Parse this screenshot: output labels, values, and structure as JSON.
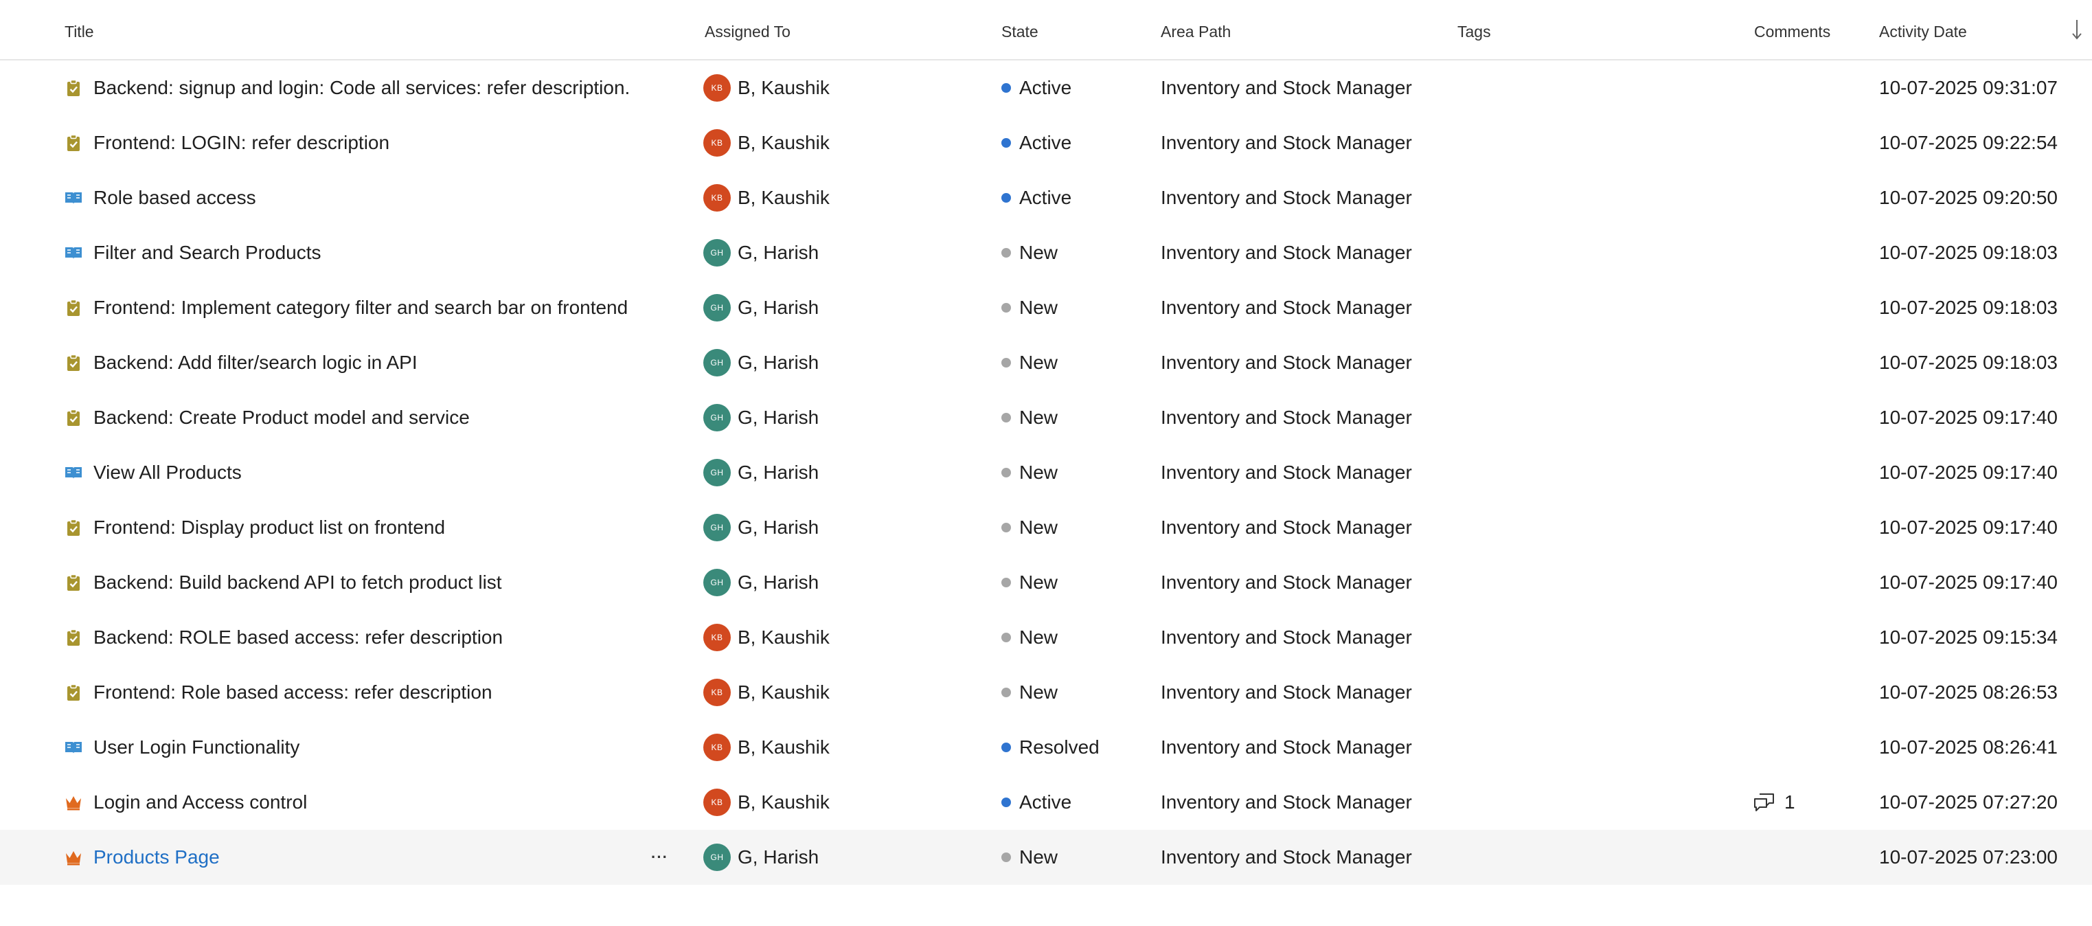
{
  "columns": {
    "title": "Title",
    "assigned_to": "Assigned To",
    "state": "State",
    "area_path": "Area Path",
    "tags": "Tags",
    "comments": "Comments",
    "activity_date": "Activity Date"
  },
  "colors": {
    "task_icon": "#a8952f",
    "story_icon": "#3d8fd1",
    "epic_icon": "#e06a1f",
    "state_active": "#2f74d0",
    "state_resolved": "#2f74d0",
    "state_new": "#a6a6a6",
    "avatar_kb": "#d2491f",
    "avatar_gh": "#3a8a7a",
    "link": "#1f6fc5"
  },
  "rows": [
    {
      "type": "task",
      "title": "Backend: signup and login: Code all services: refer description.",
      "initials": "KB",
      "assignee": "B, Kaushik",
      "state": "Active",
      "area": "Inventory and Stock Manager",
      "comments": "",
      "date": "10-07-2025 09:31:07"
    },
    {
      "type": "task",
      "title": "Frontend: LOGIN: refer description",
      "initials": "KB",
      "assignee": "B, Kaushik",
      "state": "Active",
      "area": "Inventory and Stock Manager",
      "comments": "",
      "date": "10-07-2025 09:22:54"
    },
    {
      "type": "story",
      "title": "Role based access",
      "initials": "KB",
      "assignee": "B, Kaushik",
      "state": "Active",
      "area": "Inventory and Stock Manager",
      "comments": "",
      "date": "10-07-2025 09:20:50"
    },
    {
      "type": "story",
      "title": "Filter and Search Products",
      "initials": "GH",
      "assignee": "G, Harish",
      "state": "New",
      "area": "Inventory and Stock Manager",
      "comments": "",
      "date": "10-07-2025 09:18:03"
    },
    {
      "type": "task",
      "title": "Frontend: Implement category filter and search bar on frontend",
      "initials": "GH",
      "assignee": "G, Harish",
      "state": "New",
      "area": "Inventory and Stock Manager",
      "comments": "",
      "date": "10-07-2025 09:18:03"
    },
    {
      "type": "task",
      "title": "Backend: Add filter/search logic in API",
      "initials": "GH",
      "assignee": "G, Harish",
      "state": "New",
      "area": "Inventory and Stock Manager",
      "comments": "",
      "date": "10-07-2025 09:18:03"
    },
    {
      "type": "task",
      "title": "Backend: Create Product model and service",
      "initials": "GH",
      "assignee": "G, Harish",
      "state": "New",
      "area": "Inventory and Stock Manager",
      "comments": "",
      "date": "10-07-2025 09:17:40"
    },
    {
      "type": "story",
      "title": "View All Products",
      "initials": "GH",
      "assignee": "G, Harish",
      "state": "New",
      "area": "Inventory and Stock Manager",
      "comments": "",
      "date": "10-07-2025 09:17:40"
    },
    {
      "type": "task",
      "title": "Frontend: Display product list on frontend",
      "initials": "GH",
      "assignee": "G, Harish",
      "state": "New",
      "area": "Inventory and Stock Manager",
      "comments": "",
      "date": "10-07-2025 09:17:40"
    },
    {
      "type": "task",
      "title": "Backend: Build backend API to fetch product list",
      "initials": "GH",
      "assignee": "G, Harish",
      "state": "New",
      "area": "Inventory and Stock Manager",
      "comments": "",
      "date": "10-07-2025 09:17:40"
    },
    {
      "type": "task",
      "title": "Backend: ROLE based access: refer description",
      "initials": "KB",
      "assignee": "B, Kaushik",
      "state": "New",
      "area": "Inventory and Stock Manager",
      "comments": "",
      "date": "10-07-2025 09:15:34"
    },
    {
      "type": "task",
      "title": "Frontend: Role based access: refer description",
      "initials": "KB",
      "assignee": "B, Kaushik",
      "state": "New",
      "area": "Inventory and Stock Manager",
      "comments": "",
      "date": "10-07-2025 08:26:53"
    },
    {
      "type": "story",
      "title": "User Login Functionality",
      "initials": "KB",
      "assignee": "B, Kaushik",
      "state": "Resolved",
      "area": "Inventory and Stock Manager",
      "comments": "",
      "date": "10-07-2025 08:26:41"
    },
    {
      "type": "epic",
      "title": "Login and Access control",
      "initials": "KB",
      "assignee": "B, Kaushik",
      "state": "Active",
      "area": "Inventory and Stock Manager",
      "comments": "1",
      "date": "10-07-2025 07:27:20"
    },
    {
      "type": "epic",
      "title": "Products Page",
      "initials": "GH",
      "assignee": "G, Harish",
      "state": "New",
      "area": "Inventory and Stock Manager",
      "comments": "",
      "date": "10-07-2025 07:23:00",
      "highlight": true,
      "link": true,
      "more": "···"
    }
  ]
}
